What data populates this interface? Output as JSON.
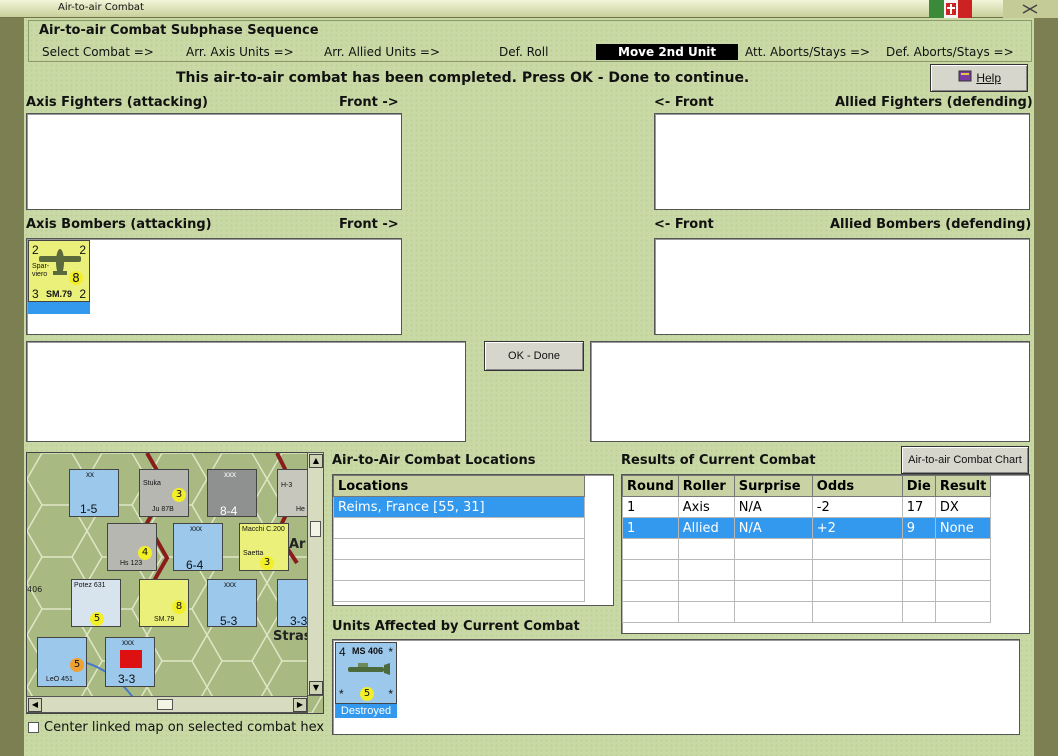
{
  "window": {
    "title": "Air-to-air Combat"
  },
  "sequence": {
    "title": "Air-to-air Combat Subphase Sequence",
    "steps": [
      "Select Combat =>",
      "Arr. Axis Units =>",
      "Arr. Allied Units =>",
      "Def. Roll",
      "Move 2nd Unit",
      "Att. Aborts/Stays =>",
      "Def. Aborts/Stays =>"
    ],
    "active_step": "Move 2nd Unit"
  },
  "status_message": "This air-to-air combat has been completed.  Press OK - Done to continue.",
  "help_label": "Help",
  "axis_fighters": {
    "label": "Axis Fighters (attacking)",
    "front": "Front ->"
  },
  "allied_fighters": {
    "label": "Allied Fighters (defending)",
    "front": "<- Front"
  },
  "axis_bombers": {
    "label": "Axis Bombers (attacking)",
    "front": "Front ->"
  },
  "allied_bombers": {
    "label": "Allied Bombers (defending)",
    "front": "<- Front"
  },
  "bomber_counter": {
    "tl": "2",
    "tr": "2",
    "bl": "3",
    "br": "2",
    "name_line1": "Spar-",
    "name_line2": "viero",
    "model": "SM.79",
    "dot": "8"
  },
  "ok_done_label": "OK - Done",
  "locations": {
    "title": "Air-to-Air Combat Locations",
    "header": "Locations",
    "rows": [
      "Reims, France [55, 31]",
      "",
      "",
      "",
      ""
    ]
  },
  "results": {
    "title": "Results of Current Combat",
    "chart_button": "Air-to-air Combat Chart",
    "columns": [
      "Round",
      "Roller",
      "Surprise",
      "Odds",
      "Die",
      "Result"
    ],
    "rows": [
      [
        "1",
        "Axis",
        "N/A",
        "-2",
        "17",
        "DX"
      ],
      [
        "1",
        "Allied",
        "N/A",
        "+2",
        "9",
        "None"
      ],
      [
        "",
        "",
        "",
        "",
        "",
        ""
      ],
      [
        "",
        "",
        "",
        "",
        "",
        ""
      ],
      [
        "",
        "",
        "",
        "",
        "",
        ""
      ],
      [
        "",
        "",
        "",
        "",
        "",
        ""
      ]
    ]
  },
  "units_affected": {
    "title": "Units Affected by Current Combat",
    "counter": {
      "tl": "4",
      "model": "MS 406",
      "tr": "*",
      "bl": "*",
      "br": "*",
      "dot": "5",
      "status": "Destroyed"
    }
  },
  "map": {
    "counters": [
      {
        "top": "xx",
        "value": "1-5",
        "side": "Cav Rec"
      },
      {
        "top": "",
        "value": "",
        "name": "Stuka",
        "model": "Ju 87B",
        "dot": "3"
      },
      {
        "top": "xxx",
        "value": "8-4",
        "side": "XVII Mot"
      },
      {
        "name": "H-3",
        "model": "He 111"
      },
      {
        "name": "",
        "model": "Hs 123",
        "dot": "4"
      },
      {
        "top": "xxx",
        "value": "6-4",
        "side": "V Inf"
      },
      {
        "name": "Macchi C.200",
        "model": "Saetta",
        "dot": "3"
      },
      {
        "name": "Potez 631",
        "dot": "5"
      },
      {
        "name": "",
        "model": "SM.79",
        "dot": "8"
      },
      {
        "top": "xxx",
        "value": "5-3",
        "side": "XIII Inf"
      },
      {
        "value": "3-3",
        "side": "Mot"
      },
      {
        "model": "LeO 451",
        "dot": "5"
      },
      {
        "top": "xxx",
        "value": "3-3",
        "side": "MAR"
      }
    ],
    "labels": [
      "Ar",
      "Stras",
      "406"
    ]
  },
  "center_checkbox_label": "Center linked map on selected combat hex"
}
